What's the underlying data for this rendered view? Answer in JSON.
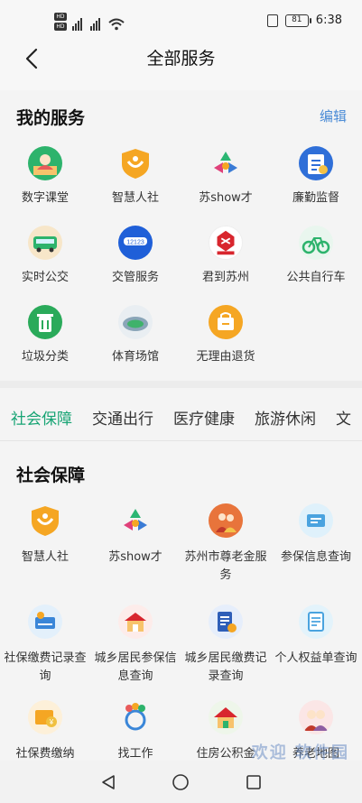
{
  "status": {
    "time": "6:38",
    "battery": "81",
    "sim1": "HD",
    "sim2": "HD"
  },
  "header": {
    "title": "全部服务"
  },
  "my_services": {
    "title": "我的服务",
    "edit_label": "编辑",
    "items": [
      {
        "label": "数字课堂",
        "icon": "digital-classroom-icon",
        "color": "#2db36c"
      },
      {
        "label": "智慧人社",
        "icon": "smart-hr-icon",
        "color": "#f5a623"
      },
      {
        "label": "苏show才",
        "icon": "su-show-talent-icon",
        "color": "#e8e8e8"
      },
      {
        "label": "廉勤监督",
        "icon": "integrity-supervision-icon",
        "color": "#2f6fd8"
      },
      {
        "label": "实时公交",
        "icon": "realtime-bus-icon",
        "color": "#e6a86a"
      },
      {
        "label": "交管服务",
        "icon": "traffic-service-icon",
        "color": "#1f5fd8"
      },
      {
        "label": "君到苏州",
        "icon": "jun-dao-suzhou-icon",
        "color": "#ffffff"
      },
      {
        "label": "公共自行车",
        "icon": "public-bicycle-icon",
        "color": "#e9f6ee"
      },
      {
        "label": "垃圾分类",
        "icon": "garbage-sorting-icon",
        "color": "#2aaa5a"
      },
      {
        "label": "体育场馆",
        "icon": "sports-venue-icon",
        "color": "#eeeeee"
      },
      {
        "label": "无理由退货",
        "icon": "no-reason-return-icon",
        "color": "#f5a623"
      }
    ]
  },
  "tabs": [
    {
      "label": "社会保障",
      "active": true
    },
    {
      "label": "交通出行",
      "active": false
    },
    {
      "label": "医疗健康",
      "active": false
    },
    {
      "label": "旅游休闲",
      "active": false
    },
    {
      "label": "文",
      "active": false
    }
  ],
  "social_security": {
    "title": "社会保障",
    "items": [
      {
        "label": "智慧人社",
        "icon": "smart-hr-icon"
      },
      {
        "label": "苏show才",
        "icon": "su-show-talent-icon"
      },
      {
        "label": "苏州市尊老金服务",
        "icon": "elderly-allowance-icon"
      },
      {
        "label": "参保信息查询",
        "icon": "insurance-info-icon"
      },
      {
        "label": "社保缴费记录查询",
        "icon": "social-payment-record-icon"
      },
      {
        "label": "城乡居民参保信息查询",
        "icon": "resident-insurance-info-icon"
      },
      {
        "label": "城乡居民缴费记录查询",
        "icon": "resident-payment-record-icon"
      },
      {
        "label": "个人权益单查询",
        "icon": "personal-rights-icon"
      },
      {
        "label": "社保费缴纳",
        "icon": "social-fee-payment-icon"
      },
      {
        "label": "找工作",
        "icon": "find-job-icon"
      },
      {
        "label": "住房公积金",
        "icon": "housing-fund-icon"
      },
      {
        "label": "养老地图",
        "icon": "pension-map-icon"
      }
    ]
  },
  "watermark": "欢迎 软件园"
}
